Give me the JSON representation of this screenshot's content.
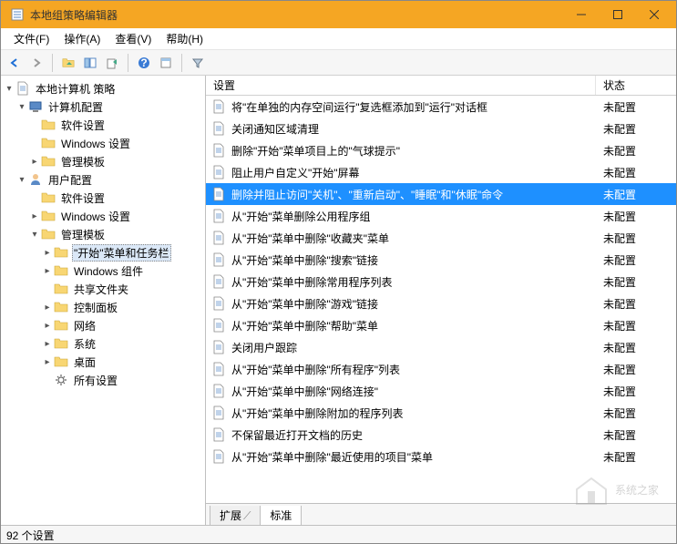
{
  "window": {
    "title": "本地组策略编辑器"
  },
  "menu": {
    "file": "文件(F)",
    "action": "操作(A)",
    "view": "查看(V)",
    "help": "帮助(H)"
  },
  "tree": {
    "root": "本地计算机 策略",
    "computer_cfg": "计算机配置",
    "user_cfg": "用户配置",
    "software": "软件设置",
    "windows": "Windows 设置",
    "admin": "管理模板",
    "start_taskbar": "\"开始\"菜单和任务栏",
    "win_components": "Windows 组件",
    "shared_folders": "共享文件夹",
    "control_panel": "控制面板",
    "network": "网络",
    "system": "系统",
    "desktop": "桌面",
    "all_settings": "所有设置"
  },
  "columns": {
    "setting": "设置",
    "status": "状态"
  },
  "status_unconfigured": "未配置",
  "settings": [
    {
      "name": "将\"在单独的内存空间运行\"复选框添加到\"运行\"对话框",
      "status": "未配置"
    },
    {
      "name": "关闭通知区域清理",
      "status": "未配置"
    },
    {
      "name": "删除\"开始\"菜单项目上的\"气球提示\"",
      "status": "未配置"
    },
    {
      "name": "阻止用户自定义\"开始\"屏幕",
      "status": "未配置"
    },
    {
      "name": "删除并阻止访问\"关机\"、\"重新启动\"、\"睡眠\"和\"休眠\"命令",
      "status": "未配置",
      "selected": true
    },
    {
      "name": "从\"开始\"菜单删除公用程序组",
      "status": "未配置"
    },
    {
      "name": "从\"开始\"菜单中删除\"收藏夹\"菜单",
      "status": "未配置"
    },
    {
      "name": "从\"开始\"菜单中删除\"搜索\"链接",
      "status": "未配置"
    },
    {
      "name": "从\"开始\"菜单中删除常用程序列表",
      "status": "未配置"
    },
    {
      "name": "从\"开始\"菜单中删除\"游戏\"链接",
      "status": "未配置"
    },
    {
      "name": "从\"开始\"菜单中删除\"帮助\"菜单",
      "status": "未配置"
    },
    {
      "name": "关闭用户跟踪",
      "status": "未配置"
    },
    {
      "name": "从\"开始\"菜单中删除\"所有程序\"列表",
      "status": "未配置"
    },
    {
      "name": "从\"开始\"菜单中删除\"网络连接\"",
      "status": "未配置"
    },
    {
      "name": "从\"开始\"菜单中删除附加的程序列表",
      "status": "未配置"
    },
    {
      "name": "不保留最近打开文档的历史",
      "status": "未配置"
    },
    {
      "name": "从\"开始\"菜单中删除\"最近使用的项目\"菜单",
      "status": "未配置"
    }
  ],
  "tabs": {
    "extended": "扩展",
    "standard": "标准"
  },
  "statusbar": "92 个设置",
  "watermark": "系统之家"
}
